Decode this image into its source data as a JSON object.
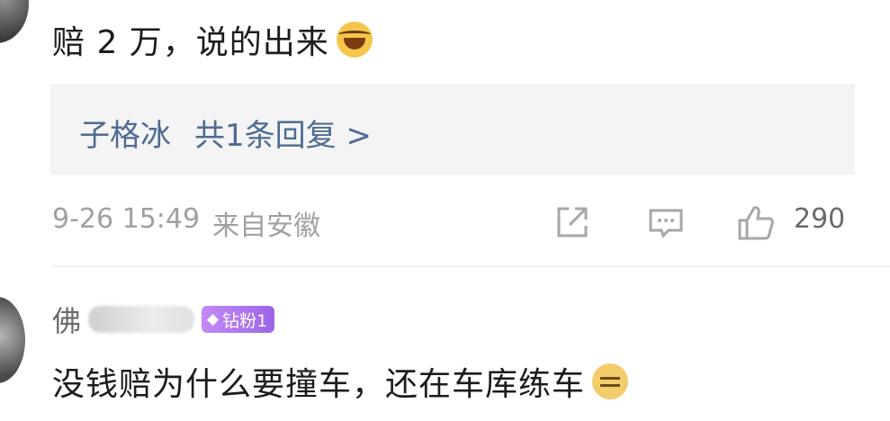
{
  "comment_1": {
    "text": "赔 2 万，说的出来",
    "emoji": "laughing-crying-face-icon"
  },
  "reply_preview": {
    "author": "子格冰",
    "summary": "共1条回复 >"
  },
  "meta": {
    "timestamp": "9-26 15:49",
    "location": "来自安徽",
    "like_count": "290"
  },
  "comment_2": {
    "username_visible": "佛",
    "fan_badge": "钻粉1",
    "text": "没钱赔为什么要撞车，还在车库练车",
    "emoji": "smirk-face-icon"
  }
}
